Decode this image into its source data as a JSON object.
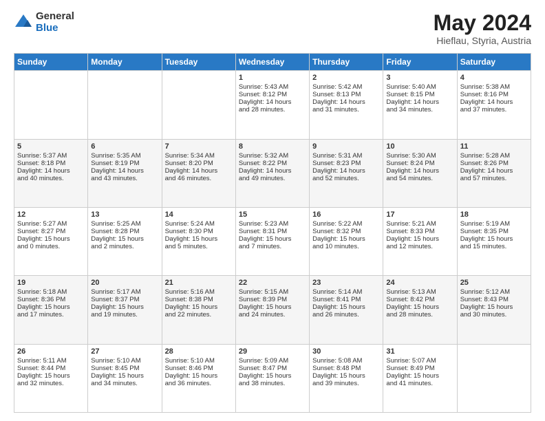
{
  "header": {
    "logo_line1": "General",
    "logo_line2": "Blue",
    "month_title": "May 2024",
    "subtitle": "Hieflau, Styria, Austria"
  },
  "days_of_week": [
    "Sunday",
    "Monday",
    "Tuesday",
    "Wednesday",
    "Thursday",
    "Friday",
    "Saturday"
  ],
  "weeks": [
    [
      {
        "day": "",
        "text": ""
      },
      {
        "day": "",
        "text": ""
      },
      {
        "day": "",
        "text": ""
      },
      {
        "day": "1",
        "text": "Sunrise: 5:43 AM\nSunset: 8:12 PM\nDaylight: 14 hours\nand 28 minutes."
      },
      {
        "day": "2",
        "text": "Sunrise: 5:42 AM\nSunset: 8:13 PM\nDaylight: 14 hours\nand 31 minutes."
      },
      {
        "day": "3",
        "text": "Sunrise: 5:40 AM\nSunset: 8:15 PM\nDaylight: 14 hours\nand 34 minutes."
      },
      {
        "day": "4",
        "text": "Sunrise: 5:38 AM\nSunset: 8:16 PM\nDaylight: 14 hours\nand 37 minutes."
      }
    ],
    [
      {
        "day": "5",
        "text": "Sunrise: 5:37 AM\nSunset: 8:18 PM\nDaylight: 14 hours\nand 40 minutes."
      },
      {
        "day": "6",
        "text": "Sunrise: 5:35 AM\nSunset: 8:19 PM\nDaylight: 14 hours\nand 43 minutes."
      },
      {
        "day": "7",
        "text": "Sunrise: 5:34 AM\nSunset: 8:20 PM\nDaylight: 14 hours\nand 46 minutes."
      },
      {
        "day": "8",
        "text": "Sunrise: 5:32 AM\nSunset: 8:22 PM\nDaylight: 14 hours\nand 49 minutes."
      },
      {
        "day": "9",
        "text": "Sunrise: 5:31 AM\nSunset: 8:23 PM\nDaylight: 14 hours\nand 52 minutes."
      },
      {
        "day": "10",
        "text": "Sunrise: 5:30 AM\nSunset: 8:24 PM\nDaylight: 14 hours\nand 54 minutes."
      },
      {
        "day": "11",
        "text": "Sunrise: 5:28 AM\nSunset: 8:26 PM\nDaylight: 14 hours\nand 57 minutes."
      }
    ],
    [
      {
        "day": "12",
        "text": "Sunrise: 5:27 AM\nSunset: 8:27 PM\nDaylight: 15 hours\nand 0 minutes."
      },
      {
        "day": "13",
        "text": "Sunrise: 5:25 AM\nSunset: 8:28 PM\nDaylight: 15 hours\nand 2 minutes."
      },
      {
        "day": "14",
        "text": "Sunrise: 5:24 AM\nSunset: 8:30 PM\nDaylight: 15 hours\nand 5 minutes."
      },
      {
        "day": "15",
        "text": "Sunrise: 5:23 AM\nSunset: 8:31 PM\nDaylight: 15 hours\nand 7 minutes."
      },
      {
        "day": "16",
        "text": "Sunrise: 5:22 AM\nSunset: 8:32 PM\nDaylight: 15 hours\nand 10 minutes."
      },
      {
        "day": "17",
        "text": "Sunrise: 5:21 AM\nSunset: 8:33 PM\nDaylight: 15 hours\nand 12 minutes."
      },
      {
        "day": "18",
        "text": "Sunrise: 5:19 AM\nSunset: 8:35 PM\nDaylight: 15 hours\nand 15 minutes."
      }
    ],
    [
      {
        "day": "19",
        "text": "Sunrise: 5:18 AM\nSunset: 8:36 PM\nDaylight: 15 hours\nand 17 minutes."
      },
      {
        "day": "20",
        "text": "Sunrise: 5:17 AM\nSunset: 8:37 PM\nDaylight: 15 hours\nand 19 minutes."
      },
      {
        "day": "21",
        "text": "Sunrise: 5:16 AM\nSunset: 8:38 PM\nDaylight: 15 hours\nand 22 minutes."
      },
      {
        "day": "22",
        "text": "Sunrise: 5:15 AM\nSunset: 8:39 PM\nDaylight: 15 hours\nand 24 minutes."
      },
      {
        "day": "23",
        "text": "Sunrise: 5:14 AM\nSunset: 8:41 PM\nDaylight: 15 hours\nand 26 minutes."
      },
      {
        "day": "24",
        "text": "Sunrise: 5:13 AM\nSunset: 8:42 PM\nDaylight: 15 hours\nand 28 minutes."
      },
      {
        "day": "25",
        "text": "Sunrise: 5:12 AM\nSunset: 8:43 PM\nDaylight: 15 hours\nand 30 minutes."
      }
    ],
    [
      {
        "day": "26",
        "text": "Sunrise: 5:11 AM\nSunset: 8:44 PM\nDaylight: 15 hours\nand 32 minutes."
      },
      {
        "day": "27",
        "text": "Sunrise: 5:10 AM\nSunset: 8:45 PM\nDaylight: 15 hours\nand 34 minutes."
      },
      {
        "day": "28",
        "text": "Sunrise: 5:10 AM\nSunset: 8:46 PM\nDaylight: 15 hours\nand 36 minutes."
      },
      {
        "day": "29",
        "text": "Sunrise: 5:09 AM\nSunset: 8:47 PM\nDaylight: 15 hours\nand 38 minutes."
      },
      {
        "day": "30",
        "text": "Sunrise: 5:08 AM\nSunset: 8:48 PM\nDaylight: 15 hours\nand 39 minutes."
      },
      {
        "day": "31",
        "text": "Sunrise: 5:07 AM\nSunset: 8:49 PM\nDaylight: 15 hours\nand 41 minutes."
      },
      {
        "day": "",
        "text": ""
      }
    ]
  ]
}
